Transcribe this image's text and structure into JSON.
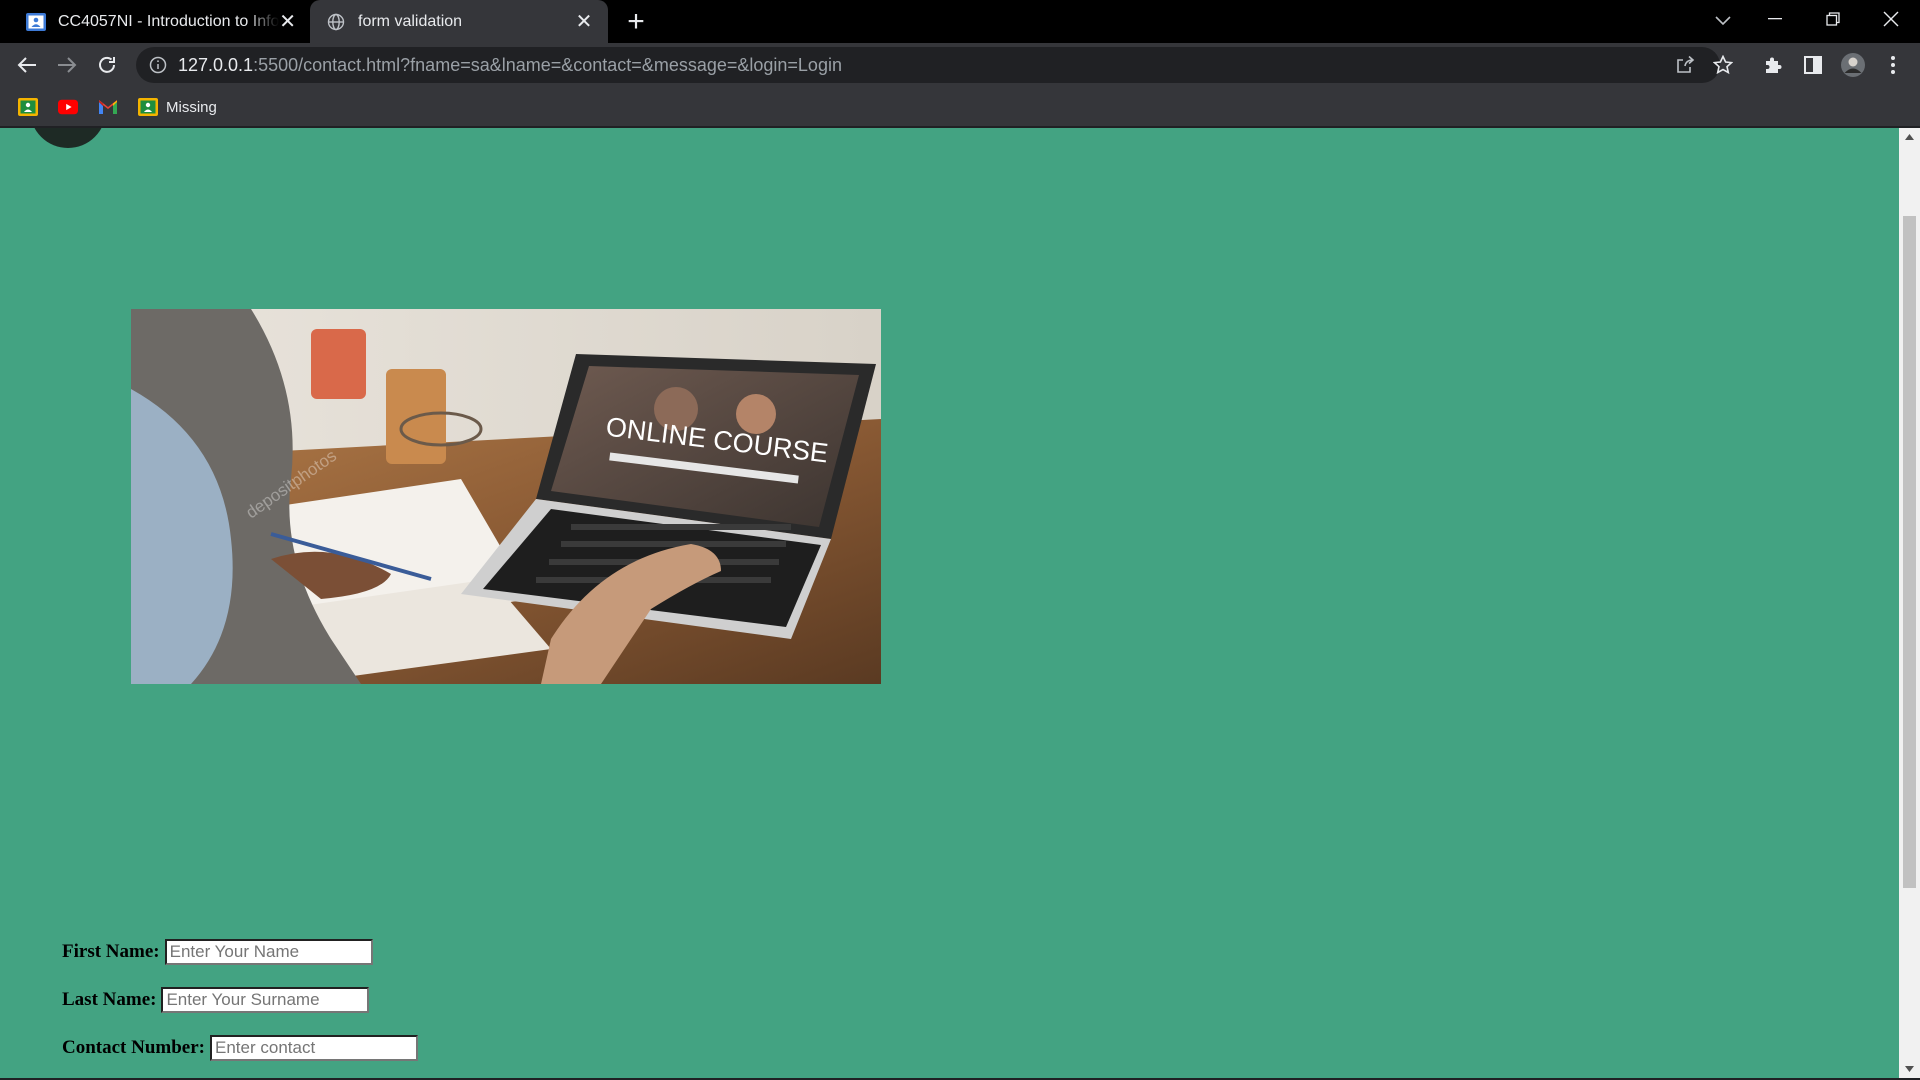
{
  "browser": {
    "tabs": [
      {
        "title": "CC4057NI - Introduction to Information Systems",
        "close": "✕"
      },
      {
        "title": "form validation",
        "close": "✕"
      }
    ],
    "new_tab": "+",
    "omnibox": {
      "url_host": "127.0.0.1",
      "url_rest": ":5500/contact.html?fname=sa&lname=&contact=&message=&login=Login"
    },
    "bookmarks": [
      {
        "label": "",
        "icon": "classroom-icon"
      },
      {
        "label": "",
        "icon": "youtube-icon"
      },
      {
        "label": "",
        "icon": "gmail-icon"
      },
      {
        "label": "Missing",
        "icon": "classroom-icon"
      }
    ]
  },
  "page": {
    "hero_image": {
      "overlay_text": "ONLINE COURSE",
      "watermark": "depositphotos"
    },
    "form": {
      "first_name": {
        "label": "First Name:",
        "placeholder": "Enter Your Name"
      },
      "last_name": {
        "label": "Last Name:",
        "placeholder": "Enter Your Surname"
      },
      "contact": {
        "label": "Contact Number:",
        "placeholder": "Enter contact"
      }
    }
  },
  "colors": {
    "page_background": "#43a382",
    "tab_strip": "#000000",
    "toolbar": "#35363a"
  }
}
